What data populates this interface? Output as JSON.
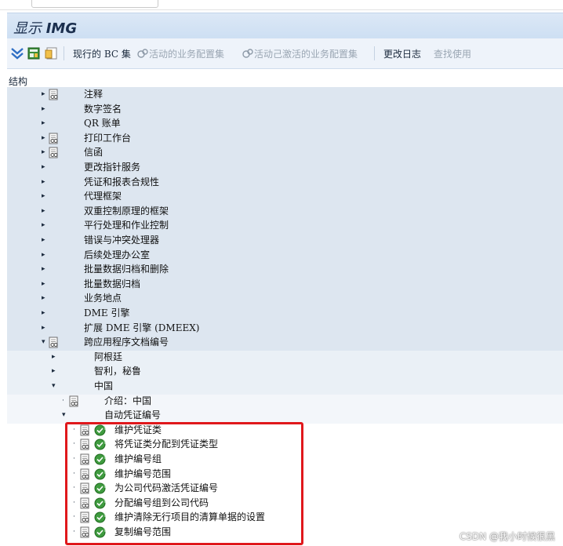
{
  "title": {
    "prefix": "显示",
    "suffix": "IMG"
  },
  "toolbar": {
    "bc_set_label": "现行的 BC 集",
    "active_config_label": "活动的业务配置集",
    "activated_config_label": "活动己激活的业务配置集",
    "change_log_label": "更改日志",
    "where_used_label": "查找使用"
  },
  "structure_header": "结构",
  "tree": {
    "top_items": [
      {
        "label": "注释",
        "icon": true
      },
      {
        "label": "数字签名",
        "icon": false
      },
      {
        "label": "QR 账单",
        "icon": false
      },
      {
        "label": "打印工作台",
        "icon": true
      },
      {
        "label": "信函",
        "icon": true
      },
      {
        "label": "更改指针服务",
        "icon": false
      },
      {
        "label": "凭证和报表合规性",
        "icon": false
      },
      {
        "label": "代理框架",
        "icon": false
      },
      {
        "label": "双重控制原理的框架",
        "icon": false
      },
      {
        "label": "平行处理和作业控制",
        "icon": false
      },
      {
        "label": "错误与冲突处理器",
        "icon": false
      },
      {
        "label": "后续处理办公室",
        "icon": false
      },
      {
        "label": "批量数据归档和删除",
        "icon": false
      },
      {
        "label": "批量数据归档",
        "icon": false
      },
      {
        "label": "业务地点",
        "icon": false
      },
      {
        "label": "DME 引擎",
        "icon": false
      },
      {
        "label": "扩展 DME 引擎 (DMEEX)",
        "icon": false
      },
      {
        "label": "跨应用程序文档编号",
        "icon": true
      }
    ],
    "country_items": [
      "阿根廷",
      "智利，秘鲁",
      "中国"
    ],
    "china_items": [
      "介绍：中国",
      "自动凭证编号"
    ],
    "auto_items": [
      "维护凭证类",
      "将凭证类分配到凭证类型",
      "维护编号组",
      "维护编号范围",
      "为公司代码激活凭证编号",
      "分配编号组到公司代码",
      "维护清除无行项目的清算单据的设置",
      "复制编号范围"
    ]
  },
  "watermark": "CSDN @我小时候很黑",
  "colors": {
    "highlight_box": "#e0181c",
    "tree_bg": "#dde6f0",
    "title_bg": "#cddff3"
  }
}
